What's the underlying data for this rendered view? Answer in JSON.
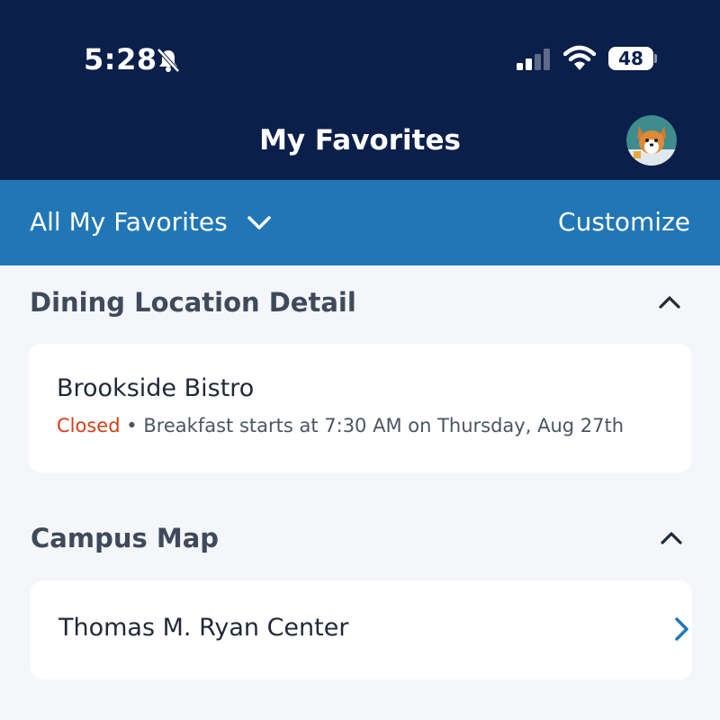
{
  "status_bar": {
    "time": "5:28",
    "battery": "48",
    "icons": [
      "bell-slash-icon",
      "cellular-signal-icon",
      "wifi-icon",
      "battery-icon"
    ]
  },
  "header": {
    "title": "My Favorites",
    "avatar_icon": "corgi-avatar-icon"
  },
  "filter_bar": {
    "selected": "All My Favorites",
    "customize_label": "Customize"
  },
  "sections": [
    {
      "title": "Dining Location Detail",
      "items": [
        {
          "name": "Brookside Bistro",
          "status": "Closed",
          "separator": "•",
          "detail": "Breakfast starts at 7:30 AM on Thursday, Aug 27th"
        }
      ]
    },
    {
      "title": "Campus Map",
      "items": [
        {
          "name": "Thomas M. Ryan Center"
        }
      ]
    }
  ],
  "colors": {
    "header_bg": "#0b1f4b",
    "subbar_bg": "#2177b6",
    "page_bg": "#f4f6fa",
    "closed": "#d2401a",
    "link_chevron": "#2177b6"
  }
}
